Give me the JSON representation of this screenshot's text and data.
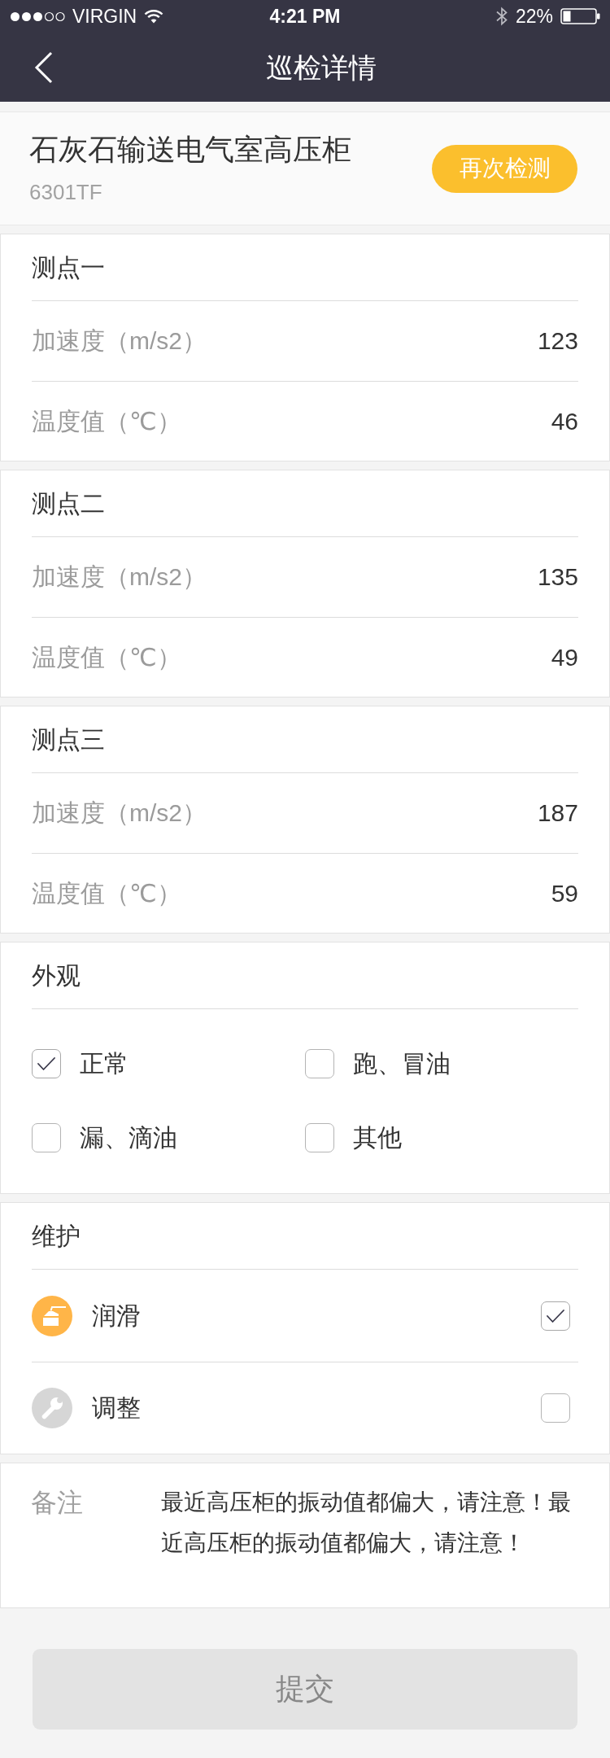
{
  "status_bar": {
    "carrier": "VIRGIN",
    "time": "4:21 PM",
    "battery": "22%"
  },
  "nav_bar": {
    "title": "巡检详情"
  },
  "device": {
    "name": "石灰石输送电气室高压柜",
    "code": "6301TF",
    "action": "再次检测"
  },
  "measurement_points": [
    {
      "title": "测点一",
      "readings": [
        {
          "label": "加速度（m/s2）",
          "value": "123"
        },
        {
          "label": "温度值（℃）",
          "value": "46"
        }
      ]
    },
    {
      "title": "测点二",
      "readings": [
        {
          "label": "加速度（m/s2）",
          "value": "135"
        },
        {
          "label": "温度值（℃）",
          "value": "49"
        }
      ]
    },
    {
      "title": "测点三",
      "readings": [
        {
          "label": "加速度（m/s2）",
          "value": "187"
        },
        {
          "label": "温度值（℃）",
          "value": "59"
        }
      ]
    }
  ],
  "appearance": {
    "title": "外观",
    "options": [
      {
        "label": "正常",
        "checked": true
      },
      {
        "label": "跑、冒油",
        "checked": false
      },
      {
        "label": "漏、滴油",
        "checked": false
      },
      {
        "label": "其他",
        "checked": false
      }
    ]
  },
  "maintenance": {
    "title": "维护",
    "items": [
      {
        "kind": "lubricate",
        "label": "润滑",
        "checked": true
      },
      {
        "kind": "adjust",
        "label": "调整",
        "checked": false
      }
    ]
  },
  "notes": {
    "label": "备注",
    "text": "最近高压柜的振动值都偏大，请注意！最近高压柜的振动值都偏大，请注意！"
  },
  "submit": {
    "label": "提交",
    "disabled": true
  }
}
